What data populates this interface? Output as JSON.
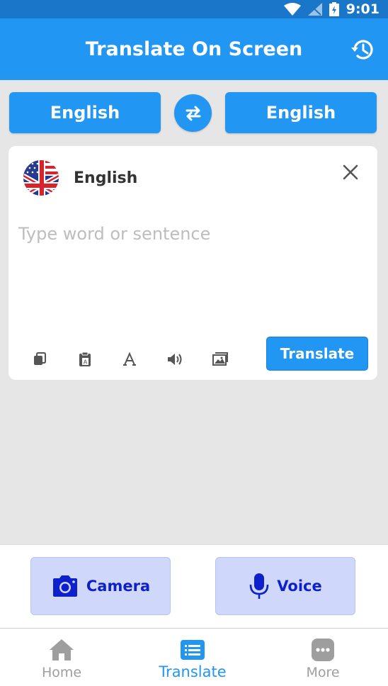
{
  "status_bar": {
    "time": "9:01"
  },
  "app_bar": {
    "title": "Translate On Screen",
    "history_icon": "history-icon"
  },
  "languages": {
    "source": "English",
    "target": "English",
    "swap_icon": "swap-icon"
  },
  "card": {
    "language": "English",
    "input_value": "",
    "input_placeholder": "Type word or sentence",
    "tools": [
      "copy-icon",
      "clipboard-icon",
      "font-icon",
      "speaker-icon",
      "image-icon"
    ],
    "translate_label": "Translate"
  },
  "actions": {
    "camera_label": "Camera",
    "voice_label": "Voice"
  },
  "nav": {
    "home": "Home",
    "translate": "Translate",
    "more": "More",
    "active": "translate"
  },
  "colors": {
    "primary": "#2196f3",
    "status_bar": "#1976c9",
    "action_bg": "#cfd8fb",
    "action_text": "#0e1fcc",
    "background": "#e6e6e6"
  }
}
